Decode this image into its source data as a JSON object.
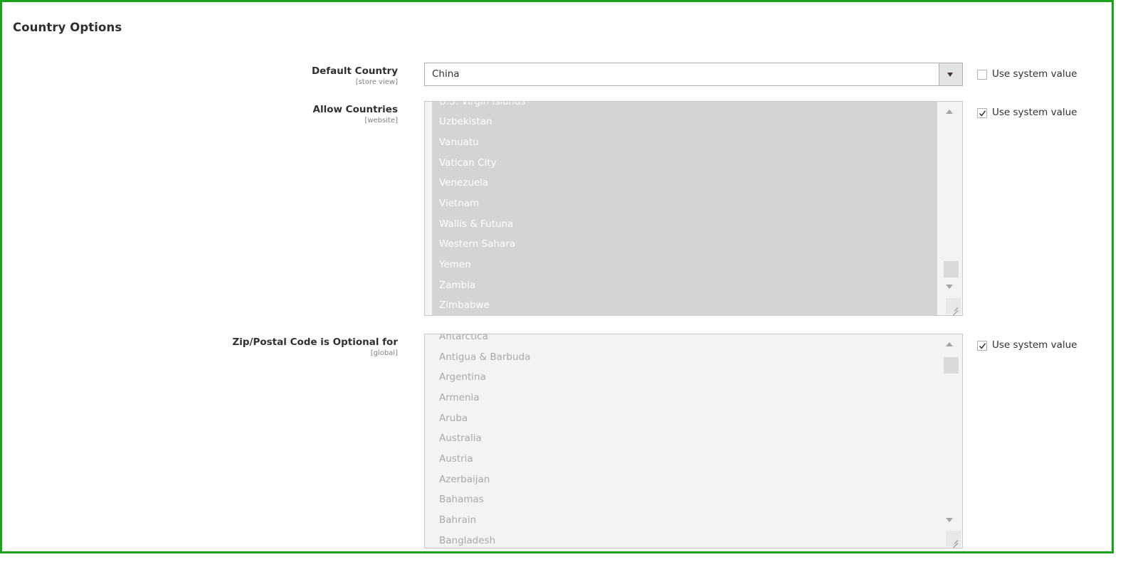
{
  "section": {
    "title": "Country Options"
  },
  "default_country": {
    "label": "Default Country",
    "scope": "[store view]",
    "value": "China",
    "use_system_value_label": "Use system value",
    "use_system_value_checked": false
  },
  "allow_countries": {
    "label": "Allow Countries",
    "scope": "[website]",
    "items": [
      "U.S. Virgin Islands",
      "Uzbekistan",
      "Vanuatu",
      "Vatican City",
      "Venezuela",
      "Vietnam",
      "Wallis & Futuna",
      "Western Sahara",
      "Yemen",
      "Zambia",
      "Zimbabwe"
    ],
    "use_system_value_label": "Use system value",
    "use_system_value_checked": true
  },
  "zip_optional": {
    "label": "Zip/Postal Code is Optional for",
    "scope": "[global]",
    "items": [
      "Antarctica",
      "Antigua & Barbuda",
      "Argentina",
      "Armenia",
      "Aruba",
      "Australia",
      "Austria",
      "Azerbaijan",
      "Bahamas",
      "Bahrain",
      "Bangladesh"
    ],
    "use_system_value_label": "Use system value",
    "use_system_value_checked": true
  },
  "icons": {
    "dropdown": "chevron-down-icon",
    "checkmark": "checkmark-icon",
    "scroll_up": "arrow-up-icon",
    "scroll_down": "arrow-down-icon",
    "resize": "resize-grip-icon"
  },
  "colors": {
    "frame": "#1aa31a",
    "selected_bg": "#d4d4d4"
  }
}
